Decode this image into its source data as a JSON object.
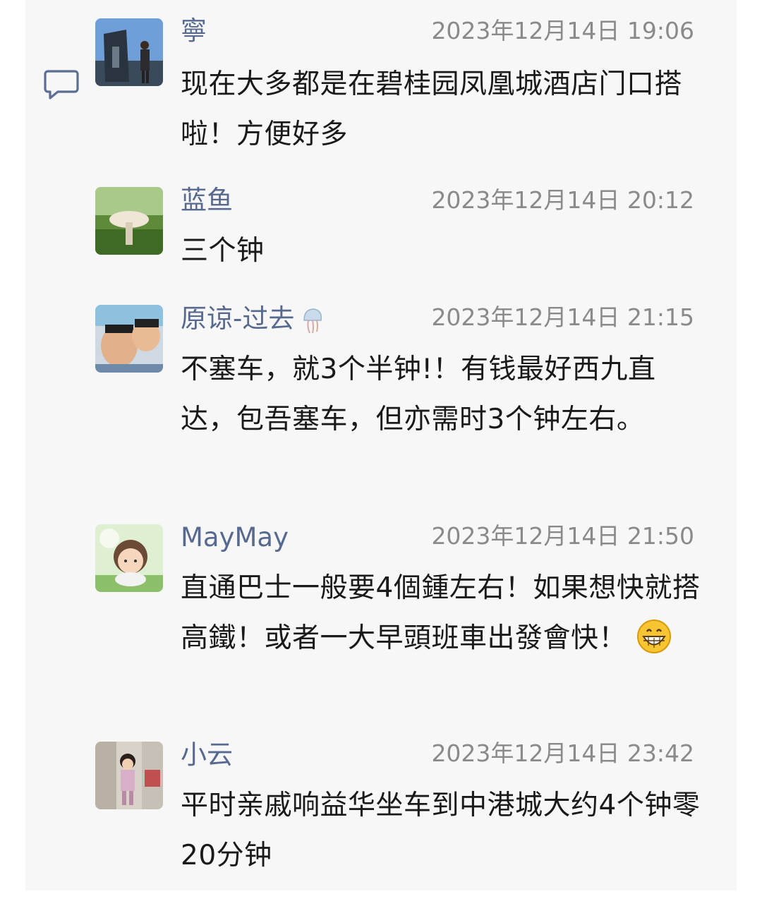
{
  "comments": [
    {
      "avatar_icon": "avatar-photo-monument",
      "name": "寧",
      "time": "2023年12月14日 19:06",
      "body": "现在大多都是在碧桂园凤凰城酒店门口搭啦！方便好多"
    },
    {
      "avatar_icon": "avatar-photo-mushroom",
      "name": "蓝鱼",
      "time": "2023年12月14日 20:12",
      "body": "三个钟"
    },
    {
      "avatar_icon": "avatar-photo-selfie",
      "name": "原谅-过去",
      "name_emoji": "jellyfish-icon",
      "time": "2023年12月14日 21:15",
      "body": "不塞车，就3个半钟!！有钱最好西九直达，包吾塞车，但亦需时3个钟左右。"
    },
    {
      "avatar_icon": "avatar-cartoon-girl",
      "name": "MayMay",
      "time": "2023年12月14日 21:50",
      "body": "直通巴士一般要4個鍾左右！如果想快就搭高鐵！或者一大早頭班車出發會快！",
      "trailing_emoji": "grinning-face-icon"
    },
    {
      "avatar_icon": "avatar-photo-child",
      "name": "小云",
      "time": "2023年12月14日 23:42",
      "body": "平时亲戚响益华坐车到中港城大约4个钟零20分钟"
    }
  ],
  "side_icon": "comment-bubble-icon",
  "colors": {
    "name": "#57698f",
    "time": "#8a8a8a",
    "text": "#1a1a1a",
    "panel": "#f7f7f7"
  }
}
